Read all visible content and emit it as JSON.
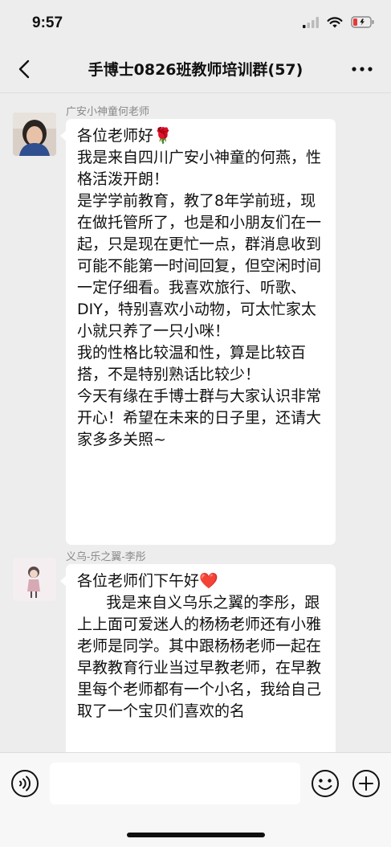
{
  "status": {
    "time": "9:57"
  },
  "header": {
    "title": "手博士0826班教师培训群(57)"
  },
  "messages": [
    {
      "sender": "广安小神童何老师",
      "text": "各位老师好🌹\n我是来自四川广安小神童的何燕，性格活泼开朗！\n是学学前教育，教了8年学前班，现在做托管所了，也是和小朋友们在一起，只是现在更忙一点，群消息收到可能不能第一时间回复，但空闲时间一定仔细看。我喜欢旅行、听歌、DIY，特别喜欢小动物，可太忙家太小就只养了一只小咪！\n我的性格比较温和性，算是比较百搭，不是特别熟话比较少！\n今天有缘在手博士群与大家认识非常开心！希望在未来的日子里，还请大家多多关照~"
    },
    {
      "sender": "义乌-乐之翼-李彤",
      "text": "各位老师们下午好❤️\n      我是来自义乌乐之翼的李彤，跟上上面可爱迷人的杨杨老师还有小雅老师是同学。其中跟杨杨老师一起在早教教育行业当过早教老师，在早教里每个老师都有一个小名，我给自己取了一个宝贝们喜欢的名"
    }
  ],
  "colors": {
    "background": "#ededed",
    "bubble": "#ffffff",
    "sender_name": "#888888",
    "battery_low": "#e53935"
  }
}
